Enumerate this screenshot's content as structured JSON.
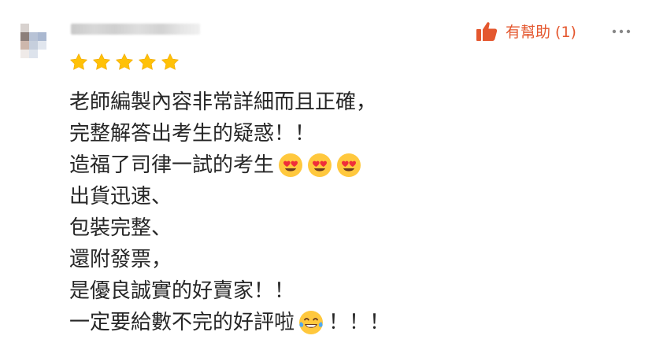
{
  "review": {
    "rating": 5,
    "max_rating": 5,
    "helpful_label": "有幫助 (1)",
    "colors": {
      "star": "#FFC107",
      "helpful_accent": "#E4572E",
      "text": "#262626",
      "menu_dots": "#888888"
    },
    "icons": {
      "helpful": "thumbs-up-icon",
      "menu": "more-options-icon",
      "rating": "star-icon",
      "emoji_heart_eyes": "heart-eyes-emoji",
      "emoji_tears_of_joy": "tears-of-joy-emoji"
    },
    "lines": [
      "老師編製內容非常詳細而且正確，",
      "完整解答出考生的疑惑！！",
      "造福了司律一試的考生",
      "出貨迅速、",
      "包裝完整、",
      "還附發票，",
      "是優良誠實的好賣家！！",
      "一定要給數不完的好評啦",
      "！！！"
    ]
  }
}
